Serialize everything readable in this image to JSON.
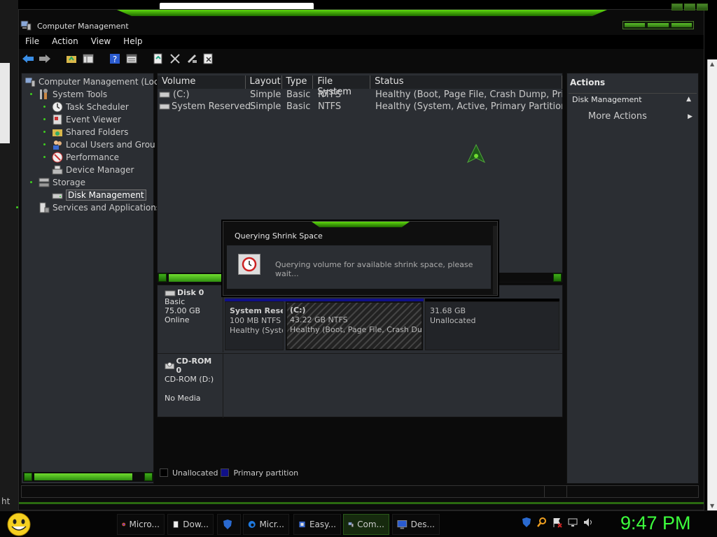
{
  "window": {
    "title": "Computer Management"
  },
  "menu": [
    "File",
    "Action",
    "View",
    "Help"
  ],
  "toolbar_icons": [
    "back-arrow-icon",
    "forward-arrow-icon",
    "up-folder-icon",
    "show-hide-console-tree-icon",
    "help-icon",
    "properties-icon",
    "refresh-icon",
    "delete-icon",
    "settings-icon",
    "export-icon"
  ],
  "tree": {
    "items": [
      {
        "label": "Computer Management (Loc",
        "icon": "computer-management-icon",
        "level": 0
      },
      {
        "label": "System Tools",
        "icon": "tools-icon",
        "level": 1
      },
      {
        "label": "Task Scheduler",
        "icon": "clock-icon",
        "level": 2
      },
      {
        "label": "Event Viewer",
        "icon": "event-viewer-icon",
        "level": 2
      },
      {
        "label": "Shared Folders",
        "icon": "shared-folder-icon",
        "level": 2
      },
      {
        "label": "Local Users and Grou",
        "icon": "users-icon",
        "level": 2
      },
      {
        "label": "Performance",
        "icon": "performance-icon",
        "level": 2
      },
      {
        "label": "Device Manager",
        "icon": "device-manager-icon",
        "level": 2
      },
      {
        "label": "Storage",
        "icon": "storage-icon",
        "level": 1
      },
      {
        "label": "Disk Management",
        "icon": "disk-icon",
        "level": 2,
        "selected": true
      },
      {
        "label": "Services and Applications",
        "icon": "services-icon",
        "level": 1
      }
    ]
  },
  "volumes": {
    "columns": [
      "Volume",
      "Layout",
      "Type",
      "File System",
      "Status"
    ],
    "rows": [
      {
        "volume": "(C:)",
        "layout": "Simple",
        "type": "Basic",
        "fs": "NTFS",
        "status": "Healthy (Boot, Page File, Crash Dump, Primar"
      },
      {
        "volume": "System Reserved",
        "layout": "Simple",
        "type": "Basic",
        "fs": "NTFS",
        "status": "Healthy (System, Active, Primary Partition)"
      }
    ]
  },
  "disks": [
    {
      "name": "Disk 0",
      "kind": "Basic",
      "size": "75.00 GB",
      "state": "Online",
      "partitions": [
        {
          "title": "System Rese",
          "line1": "100 MB NTFS",
          "line2": "Healthy (Syste"
        },
        {
          "title": "(C:)",
          "line1": "43.22 GB NTFS",
          "line2": "Healthy (Boot, Page File, Crash Dump, ,"
        },
        {
          "title": "",
          "line1": "31.68 GB",
          "line2": "Unallocated"
        }
      ]
    },
    {
      "name": "CD-ROM 0",
      "kind": "CD-ROM (D:)",
      "media": "No Media"
    }
  ],
  "legend": [
    {
      "label": "Unallocated",
      "color": "#000000"
    },
    {
      "label": "Primary partition",
      "color": "#101088"
    }
  ],
  "actions": {
    "title": "Actions",
    "section": "Disk Management",
    "item": "More Actions"
  },
  "dialog": {
    "title": "Querying Shrink Space",
    "message": "Querying volume for available shrink space, please wait..."
  },
  "taskbar": {
    "buttons": [
      {
        "label": "Micro...",
        "icon": "firefox-icon"
      },
      {
        "label": "Dow...",
        "icon": "document-icon"
      },
      {
        "label": "",
        "icon": "shield-icon"
      },
      {
        "label": "Micr...",
        "icon": "edge-icon"
      },
      {
        "label": "Easy...",
        "icon": "easy-icon"
      },
      {
        "label": "Com...",
        "icon": "computer-management-icon",
        "active": true
      },
      {
        "label": "Des...",
        "icon": "desktop-icon"
      }
    ],
    "clock": "9:47 PM"
  },
  "background_text": "ht",
  "colors": {
    "accent": "#3fcf1f",
    "clock": "#3dff3d"
  }
}
